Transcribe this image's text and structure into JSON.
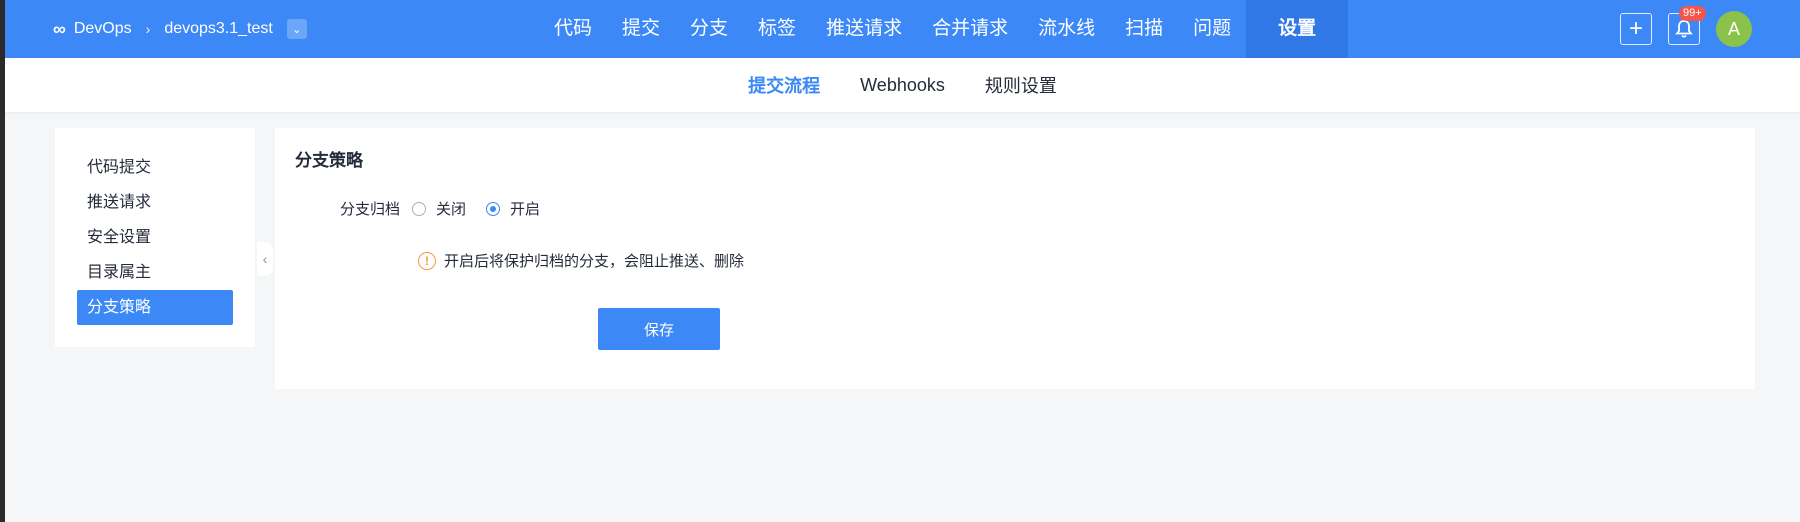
{
  "brand": {
    "logo_glyph": "∞",
    "name": "DevOps",
    "separator": "›",
    "project": "devops3.1_test",
    "dropdown_glyph": "⌄"
  },
  "main_nav": [
    "代码",
    "提交",
    "分支",
    "标签",
    "推送请求",
    "合并请求",
    "流水线",
    "扫描",
    "问题",
    "设置"
  ],
  "main_nav_active": "设置",
  "top_actions": {
    "add_glyph": "+",
    "bell_glyph": "🔔",
    "notification_badge": "99+",
    "avatar_letter": "A"
  },
  "sub_nav": [
    "提交流程",
    "Webhooks",
    "规则设置"
  ],
  "sub_nav_active": "提交流程",
  "left_menu": [
    "代码提交",
    "推送请求",
    "安全设置",
    "目录属主",
    "分支策略"
  ],
  "left_menu_active": "分支策略",
  "collapse_glyph": "‹",
  "content": {
    "title": "分支策略",
    "field_label": "分支归档",
    "options": [
      "关闭",
      "开启"
    ],
    "selected": "开启",
    "hint_icon": "!",
    "hint": "开启后将保护归档的分支，会阻止推送、删除",
    "save_label": "保存"
  },
  "colors": {
    "primary": "#3c88f7",
    "warning": "#f39b3c",
    "badge": "#f5564b",
    "avatar": "#8bc34a"
  }
}
